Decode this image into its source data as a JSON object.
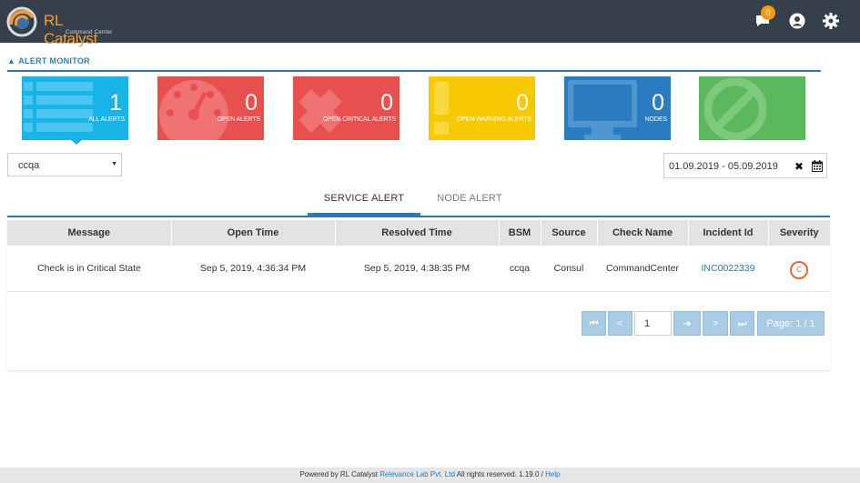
{
  "app": {
    "logo_name": "RL Catalyst",
    "logo_subtitle": "Command Center",
    "notification_count": "0"
  },
  "section": {
    "title": "ALERT MONITOR"
  },
  "cards": [
    {
      "value": "1",
      "label": "ALL ALERTS",
      "color": "#18b4e8"
    },
    {
      "value": "0",
      "label": "OPEN ALERTS",
      "color": "#e85050"
    },
    {
      "value": "0",
      "label": "OPEN CRITICAL ALERTS",
      "color": "#e85050"
    },
    {
      "value": "0",
      "label": "OPEN WARNING ALERTS",
      "color": "#f6c900"
    },
    {
      "value": "0",
      "label": "NODES",
      "color": "#2a7bbf"
    },
    {
      "value": "",
      "label": "",
      "color": "#5cb85c"
    }
  ],
  "filters": {
    "environment_value": "ccqa",
    "date_range": "01.09.2019 - 05.09.2019"
  },
  "tabs": {
    "active": "SERVICE ALERT",
    "inactive": "NODE ALERT"
  },
  "table": {
    "headers": [
      "Message",
      "Open Time",
      "Resolved Time",
      "BSM",
      "Source",
      "Check Name",
      "Incident Id",
      "Severity"
    ],
    "rows": [
      {
        "message": "Check is in Critical State",
        "open_time": "Sep 5, 2019, 4:36:34 PM",
        "resolved_time": "Sep 5, 2019, 4:38:35 PM",
        "bsm": "ccqa",
        "source": "Consul",
        "check_name": "CommandCenter",
        "incident_id": "INC0022339",
        "severity": "C"
      }
    ]
  },
  "pagination": {
    "first": "⏮",
    "prev": "<",
    "page_input": "1",
    "go": "➔",
    "next": ">",
    "last": "⏭",
    "page_info": "Page: 1 / 1"
  },
  "footer": {
    "prefix": "Powered by RL Catalyst ",
    "company": "Relevance Lab Pvt. Ltd",
    "middle": " All rights reserved. 1.19.0 / ",
    "help": "Help"
  }
}
